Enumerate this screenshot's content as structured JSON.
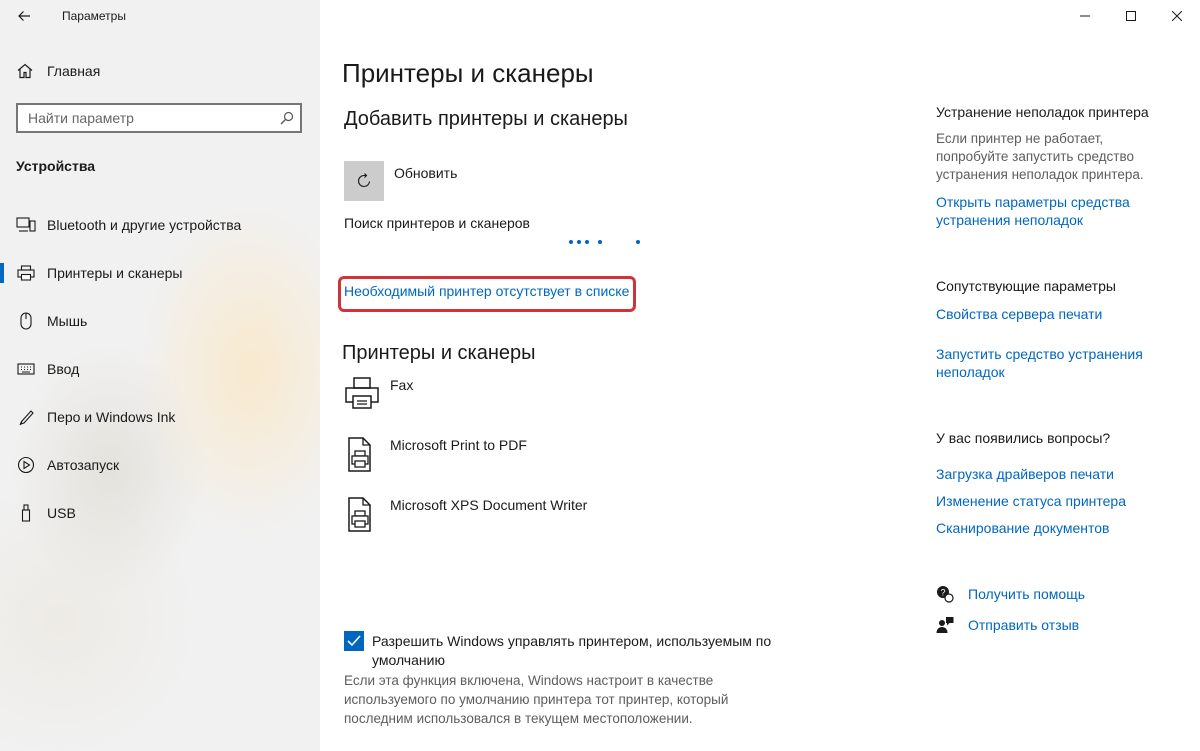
{
  "window": {
    "title": "Параметры"
  },
  "sidebar": {
    "home_label": "Главная",
    "search_placeholder": "Найти параметр",
    "section_label": "Устройства",
    "items": [
      {
        "label": "Bluetooth и другие устройства",
        "icon": "bluetooth-devices-icon"
      },
      {
        "label": "Принтеры и сканеры",
        "icon": "printer-icon",
        "selected": true
      },
      {
        "label": "Мышь",
        "icon": "mouse-icon"
      },
      {
        "label": "Ввод",
        "icon": "keyboard-icon"
      },
      {
        "label": "Перо и Windows Ink",
        "icon": "pen-icon"
      },
      {
        "label": "Автозапуск",
        "icon": "autoplay-icon"
      },
      {
        "label": "USB",
        "icon": "usb-icon"
      }
    ]
  },
  "main": {
    "title": "Принтеры и сканеры",
    "add_heading": "Добавить принтеры и сканеры",
    "refresh_label": "Обновить",
    "searching_text": "Поиск принтеров и сканеров",
    "missing_link": "Необходимый принтер отсутствует в списке",
    "printers_heading": "Принтеры и сканеры",
    "printers": [
      {
        "name": "Fax"
      },
      {
        "name": "Microsoft Print to PDF"
      },
      {
        "name": "Microsoft XPS Document Writer"
      }
    ],
    "default_checkbox": {
      "checked": true,
      "label": "Разрешить Windows управлять принтером, используемым по умолчанию",
      "description": "Если эта функция включена, Windows настроит в качестве используемого по умолчанию принтера тот принтер, который последним использовался в текущем местоположении."
    }
  },
  "right_panel": {
    "troubleshoot": {
      "heading": "Устранение неполадок принтера",
      "text": "Если принтер не работает, попробуйте запустить средство устранения неполадок принтера.",
      "link": "Открыть параметры средства устранения неполадок"
    },
    "related": {
      "heading": "Сопутствующие параметры",
      "links": [
        "Свойства сервера печати",
        "Запустить средство устранения неполадок"
      ]
    },
    "questions": {
      "heading": "У вас появились вопросы?",
      "links": [
        "Загрузка драйверов печати",
        "Изменение статуса принтера",
        "Сканирование документов"
      ]
    },
    "get_help": "Получить помощь",
    "feedback": "Отправить отзыв"
  },
  "colors": {
    "accent": "#0067c0",
    "highlight_border": "#d13438",
    "sidebar_bg": "#f1f1f1"
  }
}
